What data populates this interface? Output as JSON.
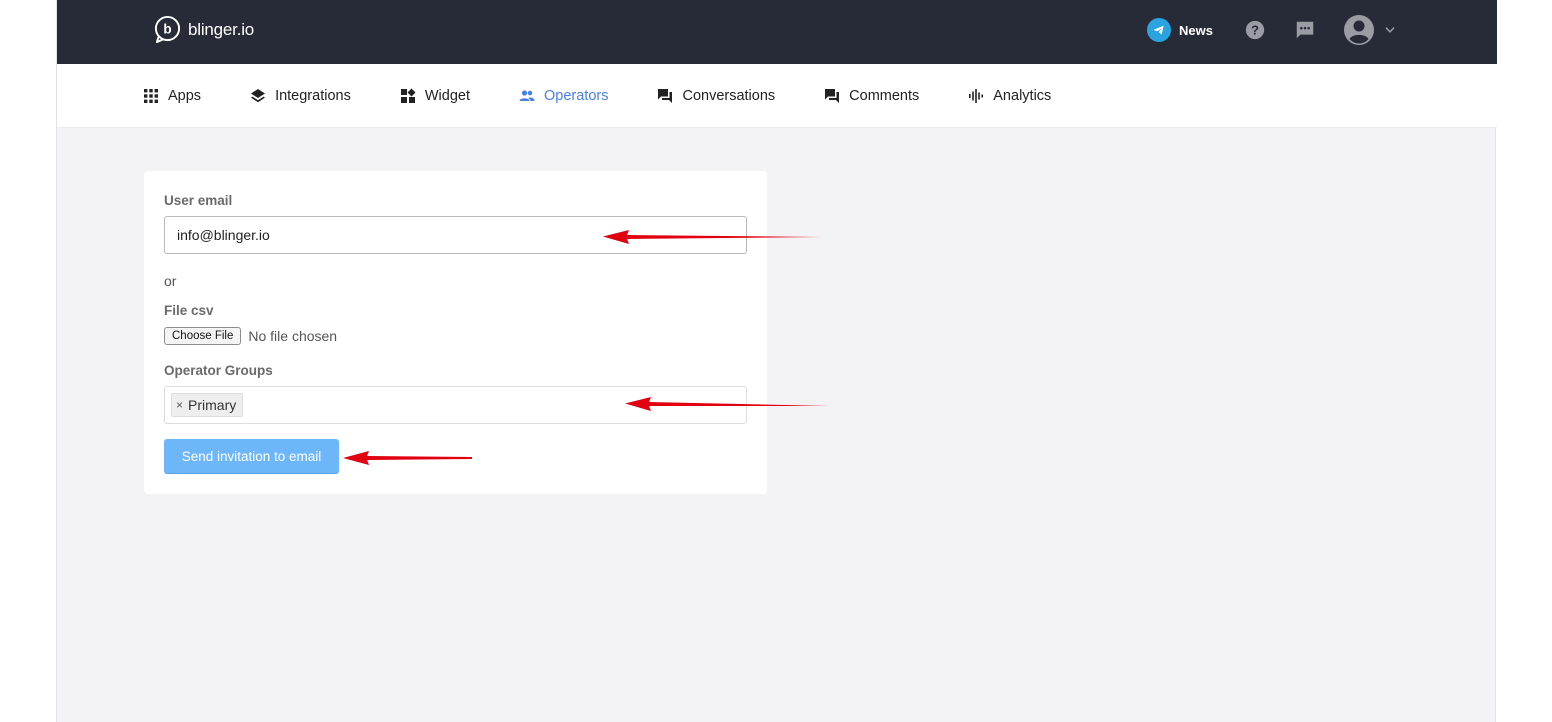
{
  "brand": {
    "name": "blinger.io",
    "icon": "blinger-logo-icon"
  },
  "topbar": {
    "news_label": "News",
    "news_icon": "telegram-icon",
    "help_icon": "help-icon",
    "chat_icon": "chat-icon",
    "avatar_icon": "user-avatar-icon",
    "chevron_icon": "chevron-down-icon"
  },
  "nav": {
    "items": [
      {
        "label": "Apps",
        "icon": "apps-grid-icon",
        "active": false
      },
      {
        "label": "Integrations",
        "icon": "layers-icon",
        "active": false
      },
      {
        "label": "Widget",
        "icon": "widget-icon",
        "active": false
      },
      {
        "label": "Operators",
        "icon": "people-icon",
        "active": true
      },
      {
        "label": "Conversations",
        "icon": "forum-icon",
        "active": false
      },
      {
        "label": "Comments",
        "icon": "comments-icon",
        "active": false
      },
      {
        "label": "Analytics",
        "icon": "analytics-icon",
        "active": false
      }
    ]
  },
  "form": {
    "email_label": "User email",
    "email_value": "info@blinger.io",
    "or_text": "or",
    "file_label": "File csv",
    "file_button": "Choose File",
    "file_status": "No file chosen",
    "groups_label": "Operator Groups",
    "groups_selected": [
      "Primary"
    ],
    "tag_remove": "×",
    "submit_label": "Send invitation to email"
  },
  "colors": {
    "topbar_bg": "#262b37",
    "accent": "#4a7fe6",
    "button_bg": "#6db6f9",
    "annotation_arrow": "#e0000f"
  }
}
